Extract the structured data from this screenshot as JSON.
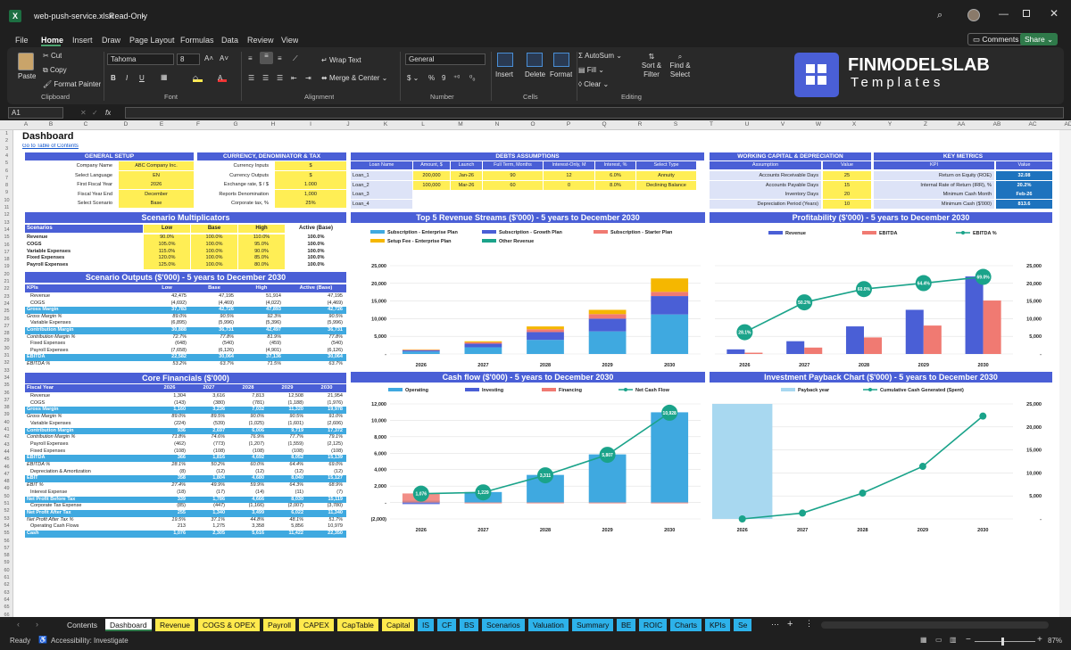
{
  "window": {
    "filename": "web-push-service.xlsx",
    "mode": "Read-Only"
  },
  "menu": [
    "File",
    "Home",
    "Insert",
    "Draw",
    "Page Layout",
    "Formulas",
    "Data",
    "Review",
    "View"
  ],
  "menu_right": {
    "comments": "Comments",
    "share": "Share"
  },
  "ribbon": {
    "clipboard": {
      "paste": "Paste",
      "cut": "Cut",
      "copy": "Copy",
      "format_painter": "Format Painter",
      "label": "Clipboard"
    },
    "font": {
      "name": "Tahoma",
      "size": "8",
      "label": "Font"
    },
    "alignment": {
      "wrap": "Wrap Text",
      "merge": "Merge & Center",
      "label": "Alignment"
    },
    "number": {
      "format": "General",
      "label": "Number"
    },
    "cells": {
      "insert": "Insert",
      "delete": "Delete",
      "format": "Format",
      "label": "Cells"
    },
    "editing": {
      "autosum": "AutoSum",
      "fill": "Fill",
      "clear": "Clear",
      "sort": "Sort & Filter",
      "find": "Find & Select",
      "label": "Editing"
    },
    "brand": {
      "name": "FINMODELSLAB",
      "sub": "Templates"
    }
  },
  "formula_bar": {
    "cell": "A1",
    "fx": "fx"
  },
  "columns": [
    "A",
    "B",
    "C",
    "D",
    "E",
    "F",
    "G",
    "H",
    "I",
    "J",
    "K",
    "L",
    "M",
    "N",
    "O",
    "P",
    "Q",
    "R",
    "S",
    "T",
    "U",
    "V",
    "W",
    "X",
    "Y",
    "Z",
    "AA",
    "AB",
    "AC",
    "AD"
  ],
  "sheet": {
    "title": "Dashboard",
    "toc": "Go to Table of Contents",
    "general": {
      "header": "GENERAL SETUP",
      "rows": [
        [
          "Company Name",
          "ABC Company Inc."
        ],
        [
          "Select Language",
          "EN"
        ],
        [
          "First Fiscal Year",
          "2026"
        ],
        [
          "Fiscal Year End",
          "December"
        ],
        [
          "Select Scenario",
          "Base"
        ]
      ]
    },
    "currency": {
      "header": "CURRENCY, DENOMINATOR & TAX",
      "rows": [
        [
          "Currency Inputs",
          "$"
        ],
        [
          "Currency Outputs",
          "$"
        ],
        [
          "Exchange rate, $ / $",
          "1.000"
        ],
        [
          "Reports Denomination",
          "1,000"
        ],
        [
          "Corporate tax, %",
          "25%"
        ]
      ]
    },
    "debts": {
      "header": "DEBTS ASSUMPTIONS",
      "cols": [
        "Loan Name",
        "Amount, $",
        "Launch",
        "Full Term, Months",
        "Interest-Only, M",
        "Interest, %",
        "Select Type"
      ],
      "rows": [
        [
          "Loan_1",
          "200,000",
          "Jan-26",
          "90",
          "12",
          "6.0%",
          "Annuity"
        ],
        [
          "Loan_2",
          "100,000",
          "Mar-26",
          "60",
          "0",
          "8.0%",
          "Declining Balance"
        ],
        [
          "Loan_3",
          "",
          "",
          "",
          "",
          "",
          ""
        ],
        [
          "Loan_4",
          "",
          "",
          "",
          "",
          "",
          ""
        ]
      ]
    },
    "wc": {
      "header": "WORKING CAPITAL & DEPRECIATION",
      "cols": [
        "Assumption",
        "Value"
      ],
      "rows": [
        [
          "Accounts Receivable Days",
          "25"
        ],
        [
          "Accounts Payable Days",
          "15"
        ],
        [
          "Inventory Days",
          "20"
        ],
        [
          "Depreciation Period (Years)",
          "10"
        ]
      ]
    },
    "kpi": {
      "header": "KEY METRICS",
      "cols": [
        "KPI",
        "Value"
      ],
      "rows": [
        [
          "Return on Equity (ROE)",
          "32.08"
        ],
        [
          "Internal Rate of Return (IRR), %",
          "20.2%"
        ],
        [
          "Minimum Cash Month",
          "Feb-26"
        ],
        [
          "Minimum Cash ($'000)",
          "813.6"
        ]
      ]
    },
    "scen_mult": {
      "title": "Scenario Multiplicators",
      "cols": [
        "Scenarios",
        "Low",
        "Base",
        "High",
        "Active (Base)"
      ],
      "rows": [
        [
          "Revenue",
          "90.0%",
          "100.0%",
          "110.0%",
          "100.0%"
        ],
        [
          "COGS",
          "105.0%",
          "100.0%",
          "95.0%",
          "100.0%"
        ],
        [
          "Variable Expenses",
          "115.0%",
          "100.0%",
          "90.0%",
          "100.0%"
        ],
        [
          "Fixed Expenses",
          "120.0%",
          "100.0%",
          "85.0%",
          "100.0%"
        ],
        [
          "Payroll Expenses",
          "125.0%",
          "100.0%",
          "80.0%",
          "100.0%"
        ]
      ]
    },
    "scen_out": {
      "title": "Scenario Outputs ($'000) - 5 years to December 2030",
      "cols": [
        "KPIs",
        "Low",
        "Base",
        "High",
        "Active (Base)"
      ],
      "rows": [
        {
          "c": [
            "Revenue",
            "42,475",
            "47,195",
            "51,914",
            "47,195"
          ],
          "s": "n"
        },
        {
          "c": [
            "COGS",
            "(4,692)",
            "(4,469)",
            "(4,022)",
            "(4,469)"
          ],
          "s": "n"
        },
        {
          "c": [
            "Gross Margin",
            "37,783",
            "42,726",
            "47,893",
            "42,726"
          ],
          "s": "h"
        },
        {
          "c": [
            "Gross Margin %",
            "89.0%",
            "90.5%",
            "92.3%",
            "90.5%"
          ],
          "s": "i"
        },
        {
          "c": [
            "Variable Expenses",
            "(6,895)",
            "(5,996)",
            "(5,396)",
            "(5,996)"
          ],
          "s": "n"
        },
        {
          "c": [
            "Contribution Margin",
            "30,888",
            "36,731",
            "42,497",
            "36,731"
          ],
          "s": "h"
        },
        {
          "c": [
            "Contribution Margin %",
            "72.7%",
            "77.8%",
            "81.9%",
            "77.8%"
          ],
          "s": "i"
        },
        {
          "c": [
            "Fixed Expenses",
            "(648)",
            "(540)",
            "(459)",
            "(540)"
          ],
          "s": "n"
        },
        {
          "c": [
            "Payroll Expenses",
            "(7,658)",
            "(6,126)",
            "(4,901)",
            "(6,126)"
          ],
          "s": "n"
        },
        {
          "c": [
            "EBITDA",
            "22,582",
            "30,064",
            "37,136",
            "30,064"
          ],
          "s": "h"
        },
        {
          "c": [
            "EBITDA %",
            "53.2%",
            "63.7%",
            "71.5%",
            "63.7%"
          ],
          "s": "i"
        }
      ]
    },
    "core": {
      "title": "Core Financials ($'000)",
      "cols": [
        "Fiscal Year",
        "2026",
        "2027",
        "2028",
        "2029",
        "2030"
      ],
      "rows": [
        {
          "c": [
            "Revenue",
            "1,304",
            "3,616",
            "7,813",
            "12,508",
            "21,954"
          ],
          "s": "n"
        },
        {
          "c": [
            "COGS",
            "(143)",
            "(380)",
            "(781)",
            "(1,188)",
            "(1,976)"
          ],
          "s": "n"
        },
        {
          "c": [
            "Gross Margin",
            "1,160",
            "3,236",
            "7,032",
            "11,320",
            "19,978"
          ],
          "s": "h"
        },
        {
          "c": [
            "Gross Margin %",
            "89.0%",
            "89.5%",
            "90.0%",
            "90.5%",
            "91.0%"
          ],
          "s": "i"
        },
        {
          "c": [
            "Variable Expenses",
            "(224)",
            "(539)",
            "(1,025)",
            "(1,601)",
            "(2,606)"
          ],
          "s": "n"
        },
        {
          "c": [
            "Contribution Margin",
            "936",
            "2,697",
            "6,006",
            "9,719",
            "17,372"
          ],
          "s": "h"
        },
        {
          "c": [
            "Contribution Margin %",
            "71.8%",
            "74.6%",
            "76.9%",
            "77.7%",
            "79.1%"
          ],
          "s": "i"
        },
        {
          "c": [
            "Payroll Expenses",
            "(462)",
            "(773)",
            "(1,207)",
            "(1,559)",
            "(2,125)"
          ],
          "s": "n"
        },
        {
          "c": [
            "Fixed Expenses",
            "(108)",
            "(108)",
            "(108)",
            "(108)",
            "(108)"
          ],
          "s": "n"
        },
        {
          "c": [
            "EBITDA",
            "366",
            "1,816",
            "4,692",
            "8,052",
            "15,139"
          ],
          "s": "h"
        },
        {
          "c": [
            "EBITDA %",
            "28.1%",
            "50.2%",
            "60.0%",
            "64.4%",
            "69.0%"
          ],
          "s": "i"
        },
        {
          "c": [
            "Depreciation & Amortization",
            "(8)",
            "(12)",
            "(12)",
            "(12)",
            "(12)"
          ],
          "s": "n"
        },
        {
          "c": [
            "EBIT",
            "358",
            "1,804",
            "4,680",
            "8,040",
            "15,127"
          ],
          "s": "h"
        },
        {
          "c": [
            "EBIT %",
            "27.4%",
            "49.9%",
            "59.9%",
            "64.3%",
            "68.9%"
          ],
          "s": "i"
        },
        {
          "c": [
            "Interest Expense",
            "(18)",
            "(17)",
            "(14)",
            "(11)",
            "(7)"
          ],
          "s": "n"
        },
        {
          "c": [
            "Net Profit Before Tax",
            "339",
            "1,786",
            "4,666",
            "8,030",
            "15,119"
          ],
          "s": "h"
        },
        {
          "c": [
            "Corporate Tax Expense",
            "(85)",
            "(447)",
            "(1,166)",
            "(2,007)",
            "(3,780)"
          ],
          "s": "n"
        },
        {
          "c": [
            "Net Profit After Tax",
            "255",
            "1,340",
            "3,499",
            "6,022",
            "11,340"
          ],
          "s": "h"
        },
        {
          "c": [
            "Net Profit After Tax %",
            "19.5%",
            "37.1%",
            "44.8%",
            "48.1%",
            "51.7%"
          ],
          "s": "i"
        },
        {
          "c": [
            "Operating Cash Flows",
            "213",
            "1,275",
            "3,358",
            "5,856",
            "10,979"
          ],
          "s": "n"
        },
        {
          "c": [
            "Cash",
            "1,076",
            "2,305",
            "5,616",
            "11,422",
            "22,350"
          ],
          "s": "h"
        }
      ]
    }
  },
  "charts": {
    "revenue": {
      "title": "Top 5 Revenue Streams ($'000) - 5 years to December 2030"
    },
    "profit": {
      "title": "Profitability ($'000) - 5 years to December 2030"
    },
    "cash": {
      "title": "Cash flow ($'000) - 5 years to December 2030"
    },
    "payback": {
      "title": "Investment Payback Chart ($'000) - 5 years to December 2030"
    }
  },
  "chart_data": [
    {
      "type": "bar",
      "stacked": true,
      "title": "Top 5 Revenue Streams ($'000) - 5 years to December 2030",
      "categories": [
        "2026",
        "2027",
        "2028",
        "2029",
        "2030"
      ],
      "ylim": [
        0,
        25000
      ],
      "yticks": [
        "-",
        "5,000",
        "10,000",
        "15,000",
        "20,000",
        "25,000"
      ],
      "series": [
        {
          "name": "Subscription - Enterprise Plan",
          "color": "#3fa9e0",
          "values": [
            700,
            1900,
            4000,
            6400,
            11200
          ]
        },
        {
          "name": "Subscription - Growth Plan",
          "color": "#4a5fd6",
          "values": [
            350,
            1000,
            2200,
            3600,
            5200
          ]
        },
        {
          "name": "Subscription - Starter Plan",
          "color": "#f07a72",
          "values": [
            150,
            400,
            800,
            1300,
            1200
          ]
        },
        {
          "name": "Setup Fee - Enterprise Plan",
          "color": "#f5b700",
          "values": [
            100,
            300,
            800,
            1200,
            3800
          ]
        },
        {
          "name": "Other Revenue",
          "color": "#1aa38a",
          "values": [
            0,
            0,
            0,
            0,
            0
          ]
        }
      ]
    },
    {
      "type": "bar",
      "title": "Profitability ($'000) - 5 years to December 2030",
      "categories": [
        "2026",
        "2027",
        "2028",
        "2029",
        "2030"
      ],
      "ylim": [
        0,
        25000
      ],
      "y2lim": [
        0,
        1
      ],
      "yticks": [
        "-",
        "5,000",
        "10,000",
        "15,000",
        "20,000",
        "25,000"
      ],
      "series": [
        {
          "name": "Revenue",
          "color": "#4a5fd6",
          "values": [
            1304,
            3616,
            7813,
            12508,
            21954
          ]
        },
        {
          "name": "EBITDA",
          "color": "#f07a72",
          "values": [
            366,
            1816,
            4692,
            8052,
            15139
          ]
        },
        {
          "name": "EBITDA %",
          "type": "line",
          "color": "#1aa38a",
          "values": [
            0.281,
            0.502,
            0.6,
            0.644,
            0.69
          ],
          "labels": [
            "28.1%",
            "50.2%",
            "60.0%",
            "64.4%",
            "69.0%"
          ]
        }
      ]
    },
    {
      "type": "bar",
      "title": "Cash flow ($'000) - 5 years to December 2030",
      "categories": [
        "2026",
        "2027",
        "2028",
        "2029",
        "2030"
      ],
      "ylim": [
        -2000,
        12000
      ],
      "yticks": [
        "(2,000)",
        "-",
        "2,000",
        "4,000",
        "6,000",
        "8,000",
        "10,000",
        "12,000"
      ],
      "series": [
        {
          "name": "Operating",
          "color": "#3fa9e0",
          "values": [
            213,
            1275,
            3358,
            5856,
            10979
          ]
        },
        {
          "name": "Investing",
          "color": "#4a5fd6",
          "values": [
            -200,
            0,
            0,
            0,
            0
          ]
        },
        {
          "name": "Financing",
          "color": "#f07a72",
          "values": [
            1100,
            -40,
            -50,
            -50,
            -50
          ]
        },
        {
          "name": "Net Cash Flow",
          "type": "line",
          "color": "#1aa38a",
          "values": [
            1076,
            1229,
            3311,
            5807,
            10928
          ],
          "labels": [
            "1,076",
            "1,229",
            "3,311",
            "5,807",
            "10,928"
          ]
        }
      ]
    },
    {
      "type": "bar",
      "title": "Investment Payback Chart ($'000) - 5 years to December 2030",
      "categories": [
        "2026",
        "2027",
        "2028",
        "2029",
        "2030"
      ],
      "ylim": [
        0,
        25000
      ],
      "yticks": [
        "-",
        "5,000",
        "10,000",
        "15,000",
        "20,000",
        "25,000"
      ],
      "series": [
        {
          "name": "Payback year",
          "color": "#a8d8f0",
          "values": [
            1,
            0,
            0,
            0,
            0
          ]
        },
        {
          "name": "Cumulative Cash Generated (Spent)",
          "type": "line",
          "color": "#1aa38a",
          "values": [
            0,
            1275,
            5616,
            11422,
            22350
          ]
        }
      ]
    }
  ],
  "tabs": [
    {
      "name": "Contents",
      "style": "plain"
    },
    {
      "name": "Dashboard",
      "style": "active"
    },
    {
      "name": "Revenue",
      "style": "y"
    },
    {
      "name": "COGS & OPEX",
      "style": "y"
    },
    {
      "name": "Payroll",
      "style": "y"
    },
    {
      "name": "CAPEX",
      "style": "y"
    },
    {
      "name": "CapTable",
      "style": "y"
    },
    {
      "name": "Capital",
      "style": "y"
    },
    {
      "name": "IS",
      "style": "b"
    },
    {
      "name": "CF",
      "style": "b"
    },
    {
      "name": "BS",
      "style": "b"
    },
    {
      "name": "Scenarios",
      "style": "b"
    },
    {
      "name": "Valuation",
      "style": "b"
    },
    {
      "name": "Summary",
      "style": "b"
    },
    {
      "name": "BE",
      "style": "b"
    },
    {
      "name": "ROIC",
      "style": "b"
    },
    {
      "name": "Charts",
      "style": "b"
    },
    {
      "name": "KPIs",
      "style": "b"
    },
    {
      "name": "Se",
      "style": "b"
    }
  ],
  "status": {
    "ready": "Ready",
    "access": "Accessibility: Investigate",
    "zoom": "87%"
  }
}
